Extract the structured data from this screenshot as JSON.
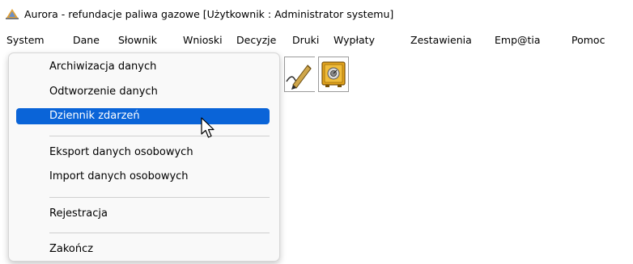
{
  "window": {
    "title": "Aurora - refundacje paliwa gazowe  [Użytkownik : Administrator systemu]",
    "app_icon": "aurora-logo-icon"
  },
  "menubar": {
    "items": [
      "System",
      "Dane",
      "Słownik",
      "Wnioski",
      "Decyzje",
      "Druki",
      "Wypłaty",
      "Zestawienia",
      "Emp@tia",
      "Pomoc"
    ]
  },
  "toolbar": {
    "icons": [
      "signature-pen-icon",
      "safe-vault-icon"
    ]
  },
  "system_menu": {
    "items": [
      "Archiwizacja danych",
      "Odtworzenie danych",
      "Dziennik zdarzeń",
      "Eksport danych osobowych",
      "Import danych osobowych",
      "Rejestracja",
      "Zakończ"
    ],
    "highlighted": "Dziennik zdarzeń",
    "highlight_color": "#0a64d8"
  },
  "cursor": "mouse-pointer-icon"
}
